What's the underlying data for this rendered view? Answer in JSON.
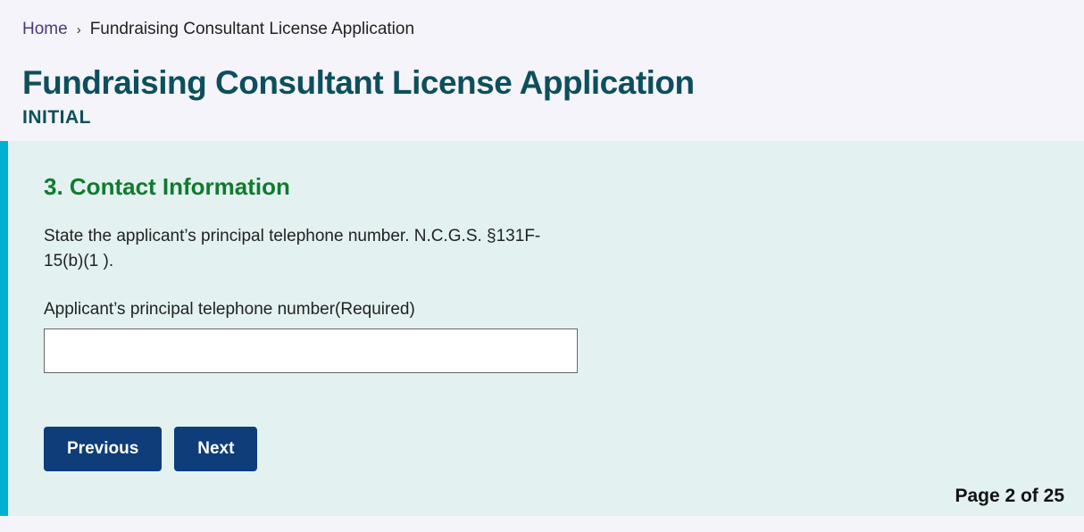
{
  "breadcrumb": {
    "home_label": "Home",
    "current_label": "Fundraising Consultant License Application"
  },
  "header": {
    "title": "Fundraising Consultant License Application",
    "subtitle": "INITIAL"
  },
  "form": {
    "section_heading": "3. Contact Information",
    "instruction": "State the applicant’s principal telephone number. N.C.G.S. §131F-15(b)(1 ).",
    "field_label": "Applicant’s principal telephone number(Required)",
    "field_value": "",
    "previous_label": "Previous",
    "next_label": "Next",
    "page_indicator": "Page 2 of 25"
  }
}
